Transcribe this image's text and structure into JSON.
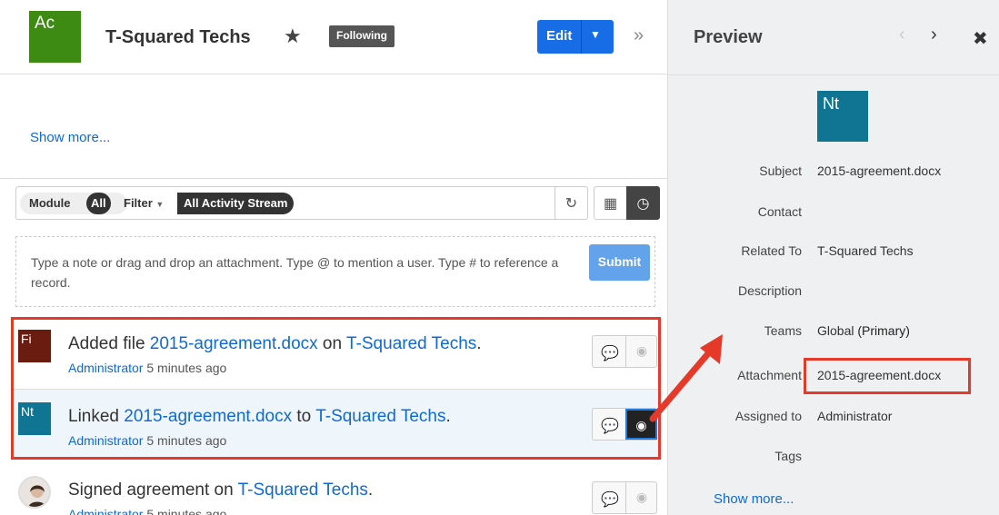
{
  "header": {
    "avatar": "Ac",
    "title": "T-Squared Techs",
    "following": "Following",
    "edit": "Edit",
    "toggle": "»"
  },
  "show_more": "Show more...",
  "filter": {
    "module_label": "Module",
    "module_value": "All",
    "filter_label": "Filter",
    "filter_value": "All Activity Stream"
  },
  "note": {
    "placeholder": "Type a note or drag and drop an attachment. Type @ to mention a user. Type # to reference a record.",
    "submit": "Submit"
  },
  "activities": [
    {
      "avatar": "Fi",
      "action": "Added file ",
      "link1": "2015-agreement.docx",
      "mid": " on ",
      "link2": "T-Squared Techs",
      "end": ".",
      "user": "Administrator",
      "time": "5 minutes ago"
    },
    {
      "avatar": "Nt",
      "action": "Linked ",
      "link1": "2015-agreement.docx",
      "mid": " to ",
      "link2": "T-Squared Techs",
      "end": ".",
      "user": "Administrator",
      "time": "5 minutes ago"
    },
    {
      "avatar": "",
      "action": "Signed agreement on ",
      "link1": "",
      "mid": "",
      "link2": "T-Squared Techs",
      "end": ".",
      "user": "Administrator",
      "time": "5 minutes ago"
    }
  ],
  "preview": {
    "title": "Preview",
    "avatar": "Nt",
    "fields": [
      {
        "label": "Subject",
        "value": "2015-agreement.docx"
      },
      {
        "label": "Contact",
        "value": ""
      },
      {
        "label": "Related To",
        "value": "T-Squared Techs"
      },
      {
        "label": "Description",
        "value": ""
      },
      {
        "label": "Teams",
        "value": "Global",
        "extra": "(Primary)"
      },
      {
        "label": "Attachment",
        "value": "2015-agreement.docx"
      },
      {
        "label": "Assigned to",
        "value": "Administrator"
      },
      {
        "label": "Tags",
        "value": ""
      }
    ],
    "show_more": "Show more..."
  },
  "colors": {
    "link": "#0f6ad3",
    "edit_button": "#176de5",
    "highlight": "#e5392a"
  }
}
